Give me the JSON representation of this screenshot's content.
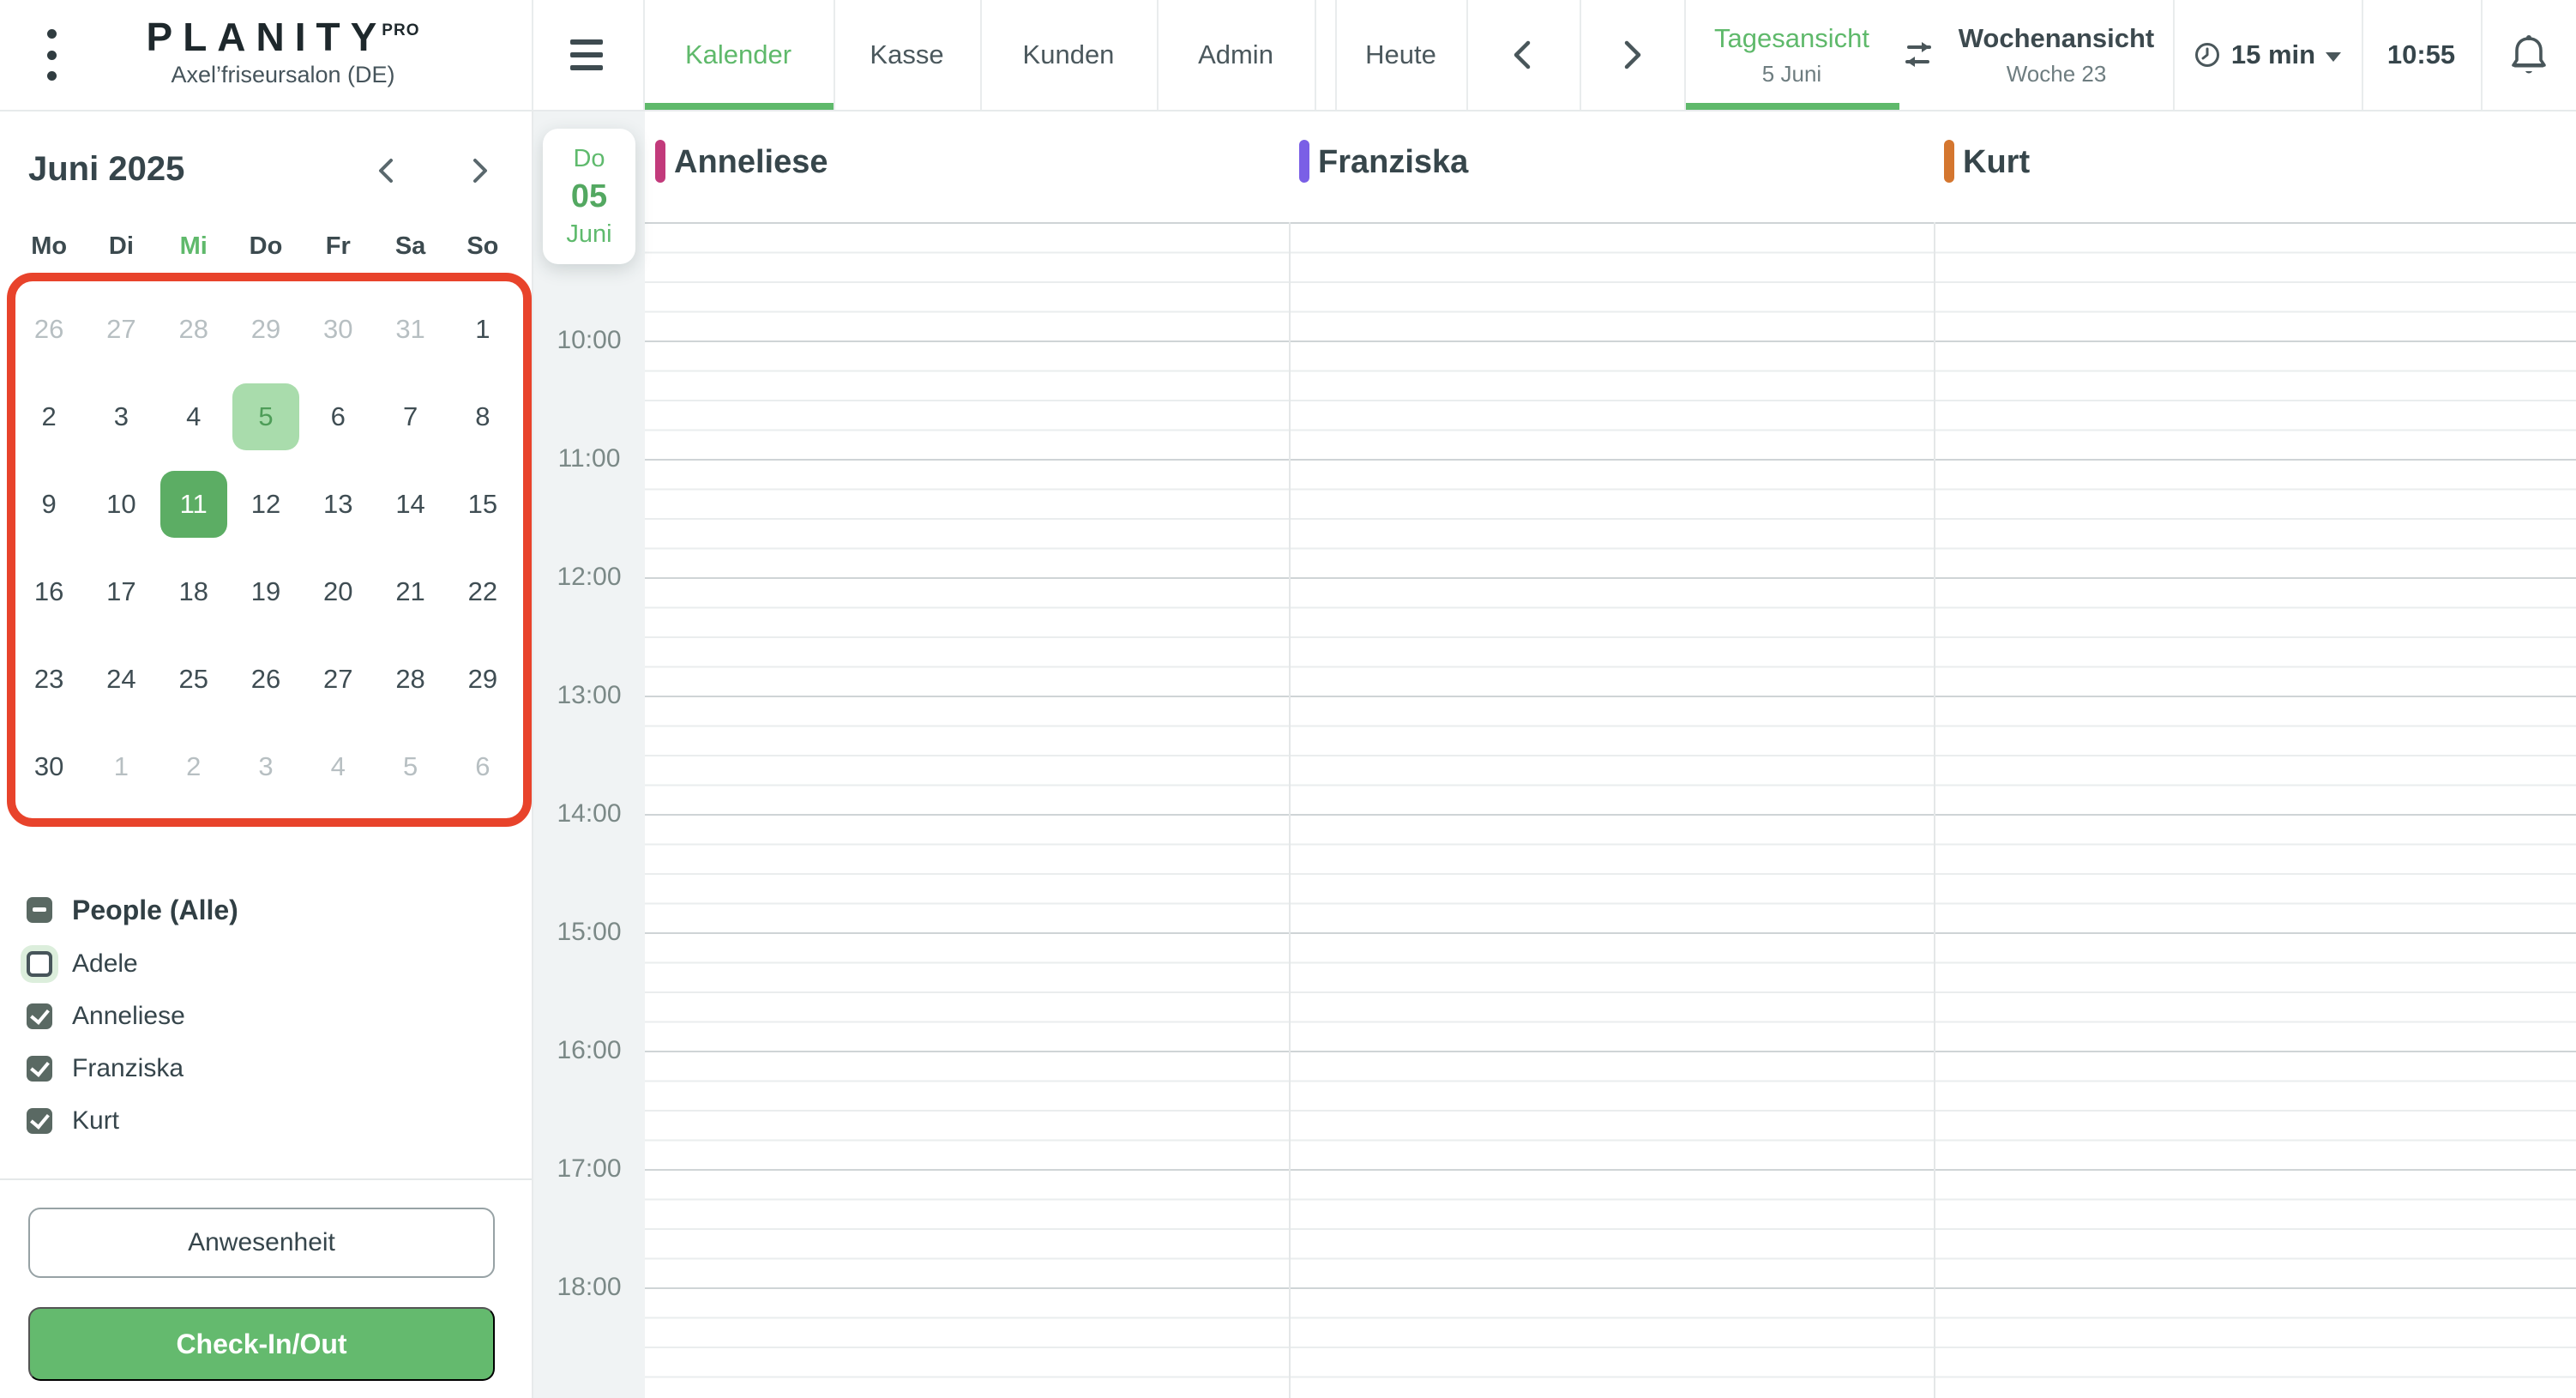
{
  "brand": {
    "logo": "PLANITY",
    "logo_suffix": "PRO",
    "subtitle": "Axel’friseursalon (DE)"
  },
  "topbar": {
    "tabs": [
      {
        "label": "Kalender",
        "active": true
      },
      {
        "label": "Kasse",
        "active": false
      },
      {
        "label": "Kunden",
        "active": false
      },
      {
        "label": "Admin",
        "active": false
      }
    ],
    "today_label": "Heute",
    "views": {
      "day": {
        "label": "Tagesansicht",
        "sublabel": "5 Juni",
        "active": true
      },
      "week": {
        "label": "Wochenansicht",
        "sublabel": "Woche 23",
        "active": false
      }
    },
    "interval_label": "15 min",
    "clock": "10:55"
  },
  "icons": {
    "kebab": "⋮",
    "hamburger": "≡",
    "chevron-left": "‹",
    "chevron-right": "›",
    "swap": "⇄",
    "clock": "◷",
    "caret-down": "▾",
    "bell": "🔔",
    "indeterminate": "−",
    "check": "✓"
  },
  "sidebar": {
    "mini_calendar": {
      "title": "Juni 2025",
      "weekdays": [
        {
          "label": "Mo",
          "today": false
        },
        {
          "label": "Di",
          "today": false
        },
        {
          "label": "Mi",
          "today": true
        },
        {
          "label": "Do",
          "today": false
        },
        {
          "label": "Fr",
          "today": false
        },
        {
          "label": "Sa",
          "today": false
        },
        {
          "label": "So",
          "today": false
        }
      ],
      "days": [
        {
          "d": "26",
          "muted": true
        },
        {
          "d": "27",
          "muted": true
        },
        {
          "d": "28",
          "muted": true
        },
        {
          "d": "29",
          "muted": true
        },
        {
          "d": "30",
          "muted": true
        },
        {
          "d": "31",
          "muted": true
        },
        {
          "d": "1"
        },
        {
          "d": "2"
        },
        {
          "d": "3"
        },
        {
          "d": "4"
        },
        {
          "d": "5",
          "sel": "light"
        },
        {
          "d": "6"
        },
        {
          "d": "7"
        },
        {
          "d": "8"
        },
        {
          "d": "9"
        },
        {
          "d": "10"
        },
        {
          "d": "11",
          "sel": "dark"
        },
        {
          "d": "12"
        },
        {
          "d": "13"
        },
        {
          "d": "14"
        },
        {
          "d": "15"
        },
        {
          "d": "16"
        },
        {
          "d": "17"
        },
        {
          "d": "18"
        },
        {
          "d": "19"
        },
        {
          "d": "20"
        },
        {
          "d": "21"
        },
        {
          "d": "22"
        },
        {
          "d": "23"
        },
        {
          "d": "24"
        },
        {
          "d": "25"
        },
        {
          "d": "26"
        },
        {
          "d": "27"
        },
        {
          "d": "28"
        },
        {
          "d": "29"
        },
        {
          "d": "30"
        },
        {
          "d": "1",
          "muted": true
        },
        {
          "d": "2",
          "muted": true
        },
        {
          "d": "3",
          "muted": true
        },
        {
          "d": "4",
          "muted": true
        },
        {
          "d": "5",
          "muted": true
        },
        {
          "d": "6",
          "muted": true
        }
      ]
    },
    "people": {
      "header": "People (Alle)",
      "items": [
        {
          "name": "Adele",
          "checked": false,
          "focus": true
        },
        {
          "name": "Anneliese",
          "checked": true
        },
        {
          "name": "Franziska",
          "checked": true
        },
        {
          "name": "Kurt",
          "checked": true
        }
      ]
    },
    "attendance_label": "Anwesenheit",
    "checkin_label": "Check-In/Out"
  },
  "schedule": {
    "date_card": {
      "weekday": "Do",
      "day": "05",
      "month": "Juni"
    },
    "staff": [
      {
        "name": "Anneliese",
        "color": "#C23A7B"
      },
      {
        "name": "Franziska",
        "color": "#7A5FE6"
      },
      {
        "name": "Kurt",
        "color": "#D4762F"
      }
    ],
    "hours": [
      "10:00",
      "11:00",
      "12:00",
      "13:00",
      "14:00",
      "15:00",
      "16:00",
      "17:00",
      "18:00"
    ]
  },
  "colors": {
    "accent_green": "#5FB96B",
    "selected_day_light_bg": "#A9DCAC",
    "selected_day_dark_bg": "#5CAD64",
    "annotation_red": "#E8432B",
    "checkbox_slate": "#5A6963",
    "gutter_gray": "#F0F3F4"
  }
}
